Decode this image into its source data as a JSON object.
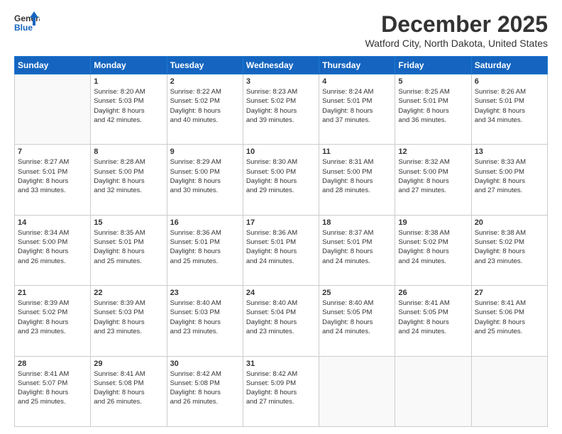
{
  "header": {
    "logo_line1": "General",
    "logo_line2": "Blue",
    "title": "December 2025",
    "subtitle": "Watford City, North Dakota, United States"
  },
  "days_of_week": [
    "Sunday",
    "Monday",
    "Tuesday",
    "Wednesday",
    "Thursday",
    "Friday",
    "Saturday"
  ],
  "weeks": [
    [
      {
        "day": "",
        "info": ""
      },
      {
        "day": "1",
        "info": "Sunrise: 8:20 AM\nSunset: 5:03 PM\nDaylight: 8 hours\nand 42 minutes."
      },
      {
        "day": "2",
        "info": "Sunrise: 8:22 AM\nSunset: 5:02 PM\nDaylight: 8 hours\nand 40 minutes."
      },
      {
        "day": "3",
        "info": "Sunrise: 8:23 AM\nSunset: 5:02 PM\nDaylight: 8 hours\nand 39 minutes."
      },
      {
        "day": "4",
        "info": "Sunrise: 8:24 AM\nSunset: 5:01 PM\nDaylight: 8 hours\nand 37 minutes."
      },
      {
        "day": "5",
        "info": "Sunrise: 8:25 AM\nSunset: 5:01 PM\nDaylight: 8 hours\nand 36 minutes."
      },
      {
        "day": "6",
        "info": "Sunrise: 8:26 AM\nSunset: 5:01 PM\nDaylight: 8 hours\nand 34 minutes."
      }
    ],
    [
      {
        "day": "7",
        "info": "Sunrise: 8:27 AM\nSunset: 5:01 PM\nDaylight: 8 hours\nand 33 minutes."
      },
      {
        "day": "8",
        "info": "Sunrise: 8:28 AM\nSunset: 5:00 PM\nDaylight: 8 hours\nand 32 minutes."
      },
      {
        "day": "9",
        "info": "Sunrise: 8:29 AM\nSunset: 5:00 PM\nDaylight: 8 hours\nand 30 minutes."
      },
      {
        "day": "10",
        "info": "Sunrise: 8:30 AM\nSunset: 5:00 PM\nDaylight: 8 hours\nand 29 minutes."
      },
      {
        "day": "11",
        "info": "Sunrise: 8:31 AM\nSunset: 5:00 PM\nDaylight: 8 hours\nand 28 minutes."
      },
      {
        "day": "12",
        "info": "Sunrise: 8:32 AM\nSunset: 5:00 PM\nDaylight: 8 hours\nand 27 minutes."
      },
      {
        "day": "13",
        "info": "Sunrise: 8:33 AM\nSunset: 5:00 PM\nDaylight: 8 hours\nand 27 minutes."
      }
    ],
    [
      {
        "day": "14",
        "info": "Sunrise: 8:34 AM\nSunset: 5:00 PM\nDaylight: 8 hours\nand 26 minutes."
      },
      {
        "day": "15",
        "info": "Sunrise: 8:35 AM\nSunset: 5:01 PM\nDaylight: 8 hours\nand 25 minutes."
      },
      {
        "day": "16",
        "info": "Sunrise: 8:36 AM\nSunset: 5:01 PM\nDaylight: 8 hours\nand 25 minutes."
      },
      {
        "day": "17",
        "info": "Sunrise: 8:36 AM\nSunset: 5:01 PM\nDaylight: 8 hours\nand 24 minutes."
      },
      {
        "day": "18",
        "info": "Sunrise: 8:37 AM\nSunset: 5:01 PM\nDaylight: 8 hours\nand 24 minutes."
      },
      {
        "day": "19",
        "info": "Sunrise: 8:38 AM\nSunset: 5:02 PM\nDaylight: 8 hours\nand 24 minutes."
      },
      {
        "day": "20",
        "info": "Sunrise: 8:38 AM\nSunset: 5:02 PM\nDaylight: 8 hours\nand 23 minutes."
      }
    ],
    [
      {
        "day": "21",
        "info": "Sunrise: 8:39 AM\nSunset: 5:02 PM\nDaylight: 8 hours\nand 23 minutes."
      },
      {
        "day": "22",
        "info": "Sunrise: 8:39 AM\nSunset: 5:03 PM\nDaylight: 8 hours\nand 23 minutes."
      },
      {
        "day": "23",
        "info": "Sunrise: 8:40 AM\nSunset: 5:03 PM\nDaylight: 8 hours\nand 23 minutes."
      },
      {
        "day": "24",
        "info": "Sunrise: 8:40 AM\nSunset: 5:04 PM\nDaylight: 8 hours\nand 23 minutes."
      },
      {
        "day": "25",
        "info": "Sunrise: 8:40 AM\nSunset: 5:05 PM\nDaylight: 8 hours\nand 24 minutes."
      },
      {
        "day": "26",
        "info": "Sunrise: 8:41 AM\nSunset: 5:05 PM\nDaylight: 8 hours\nand 24 minutes."
      },
      {
        "day": "27",
        "info": "Sunrise: 8:41 AM\nSunset: 5:06 PM\nDaylight: 8 hours\nand 25 minutes."
      }
    ],
    [
      {
        "day": "28",
        "info": "Sunrise: 8:41 AM\nSunset: 5:07 PM\nDaylight: 8 hours\nand 25 minutes."
      },
      {
        "day": "29",
        "info": "Sunrise: 8:41 AM\nSunset: 5:08 PM\nDaylight: 8 hours\nand 26 minutes."
      },
      {
        "day": "30",
        "info": "Sunrise: 8:42 AM\nSunset: 5:08 PM\nDaylight: 8 hours\nand 26 minutes."
      },
      {
        "day": "31",
        "info": "Sunrise: 8:42 AM\nSunset: 5:09 PM\nDaylight: 8 hours\nand 27 minutes."
      },
      {
        "day": "",
        "info": ""
      },
      {
        "day": "",
        "info": ""
      },
      {
        "day": "",
        "info": ""
      }
    ]
  ]
}
